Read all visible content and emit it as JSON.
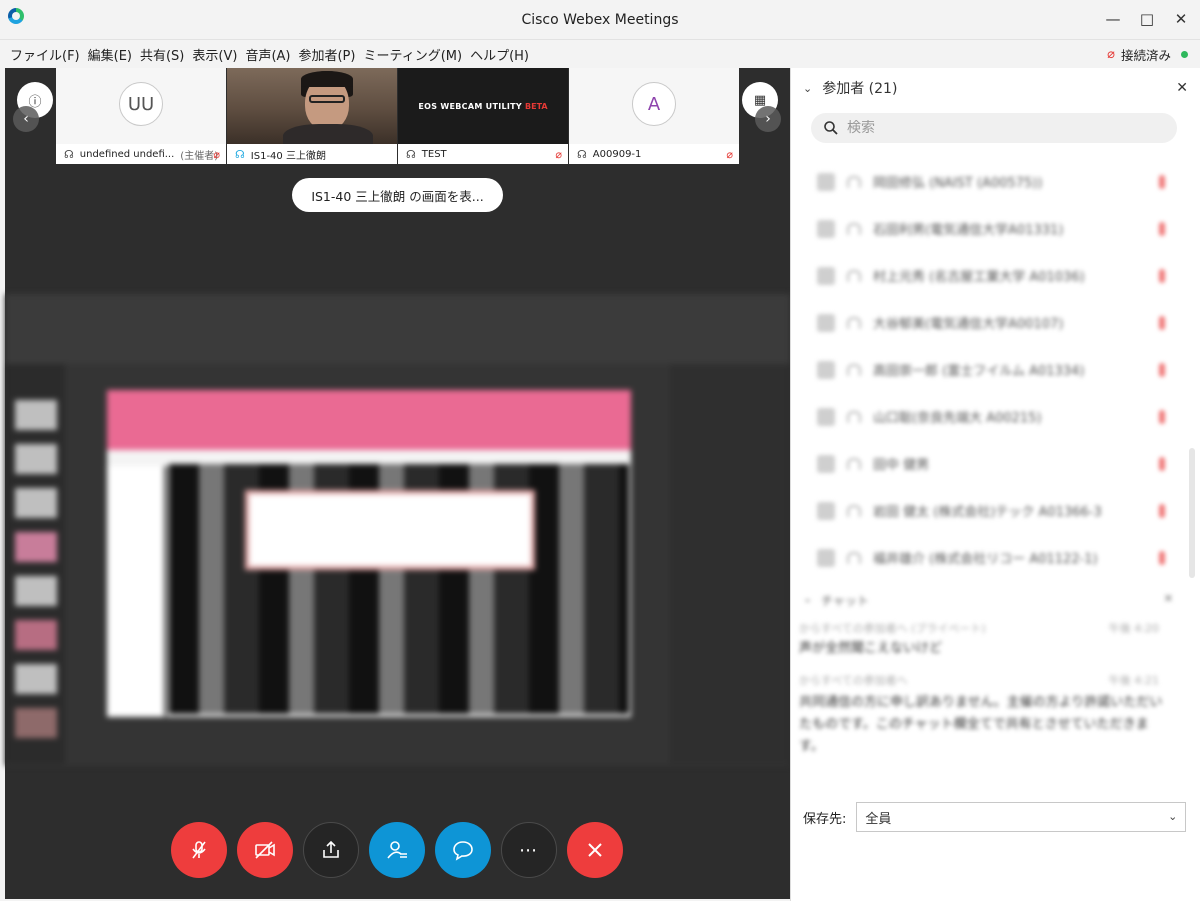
{
  "window": {
    "title": "Cisco Webex Meetings"
  },
  "menu": [
    "ファイル(F)",
    "編集(E)",
    "共有(S)",
    "表示(V)",
    "音声(A)",
    "参加者(P)",
    "ミーティング(M)",
    "ヘルプ(H)"
  ],
  "status": {
    "label": "接続済み",
    "color": "#2eb85c"
  },
  "filmstrip": {
    "tiles": [
      {
        "initials": "UU",
        "name": "undefined undefi...",
        "tag": "(主催者)",
        "muted": true,
        "type": "avatar"
      },
      {
        "name": "IS1-40 三上徹朗",
        "muted": false,
        "type": "camera",
        "active": true
      },
      {
        "name": "TEST",
        "muted": true,
        "type": "eos",
        "video_text": "EOS WEBCAM UTILITY",
        "video_badge": "BETA"
      },
      {
        "initials": "A",
        "name": "A00909-1",
        "muted": true,
        "type": "avatar"
      }
    ]
  },
  "share_notice": "IS1-40 三上徹朗 の画面を表...",
  "controls": [
    {
      "name": "mute-button",
      "icon": "mic-off-icon",
      "color": "#ee3d3d"
    },
    {
      "name": "video-button",
      "icon": "video-off-icon",
      "color": "#ee3d3d"
    },
    {
      "name": "share-button",
      "icon": "share-icon",
      "color": "#252525"
    },
    {
      "name": "participants-button",
      "icon": "participants-icon",
      "color": "#0e95d6"
    },
    {
      "name": "chat-button",
      "icon": "chat-icon",
      "color": "#0e95d6"
    },
    {
      "name": "more-button",
      "icon": "more-icon",
      "color": "#252525"
    },
    {
      "name": "leave-button",
      "icon": "close-icon",
      "color": "#ee3d3d"
    }
  ],
  "participants": {
    "header": "参加者 (21)",
    "search_placeholder": "検索",
    "items": [
      "岡田修弘 (NAIST (A00575))",
      "石田利男(電気通信大学A01331)",
      "村上元秀 (名古屋工業大学 A01036)",
      "大谷郁美(電気通信大学A00107)",
      "高田崇一郎 (富士フイルム A01334)",
      "山口聡(奈良先端大 A00215)",
      "田中 健男",
      "岩田 健太 (株式会社)テック A01366-3",
      "福井雄介 (株式会社リコー A01122-1)"
    ]
  },
  "chat": {
    "header": "チャット",
    "messages": [
      {
        "from": "からすべての参加者へ (プライベート)",
        "time": "午後 4:20",
        "text": "声が全然聞こえないけど"
      },
      {
        "from": "からすべての参加者へ",
        "time": "午後 4:21",
        "text": "共同通信の方に申し訳ありません。主催の方より許諾いただいたものです。このチャット欄全てで共有とさせていただきます。"
      }
    ]
  },
  "send_to": {
    "label": "保存先:",
    "value": "全員"
  }
}
